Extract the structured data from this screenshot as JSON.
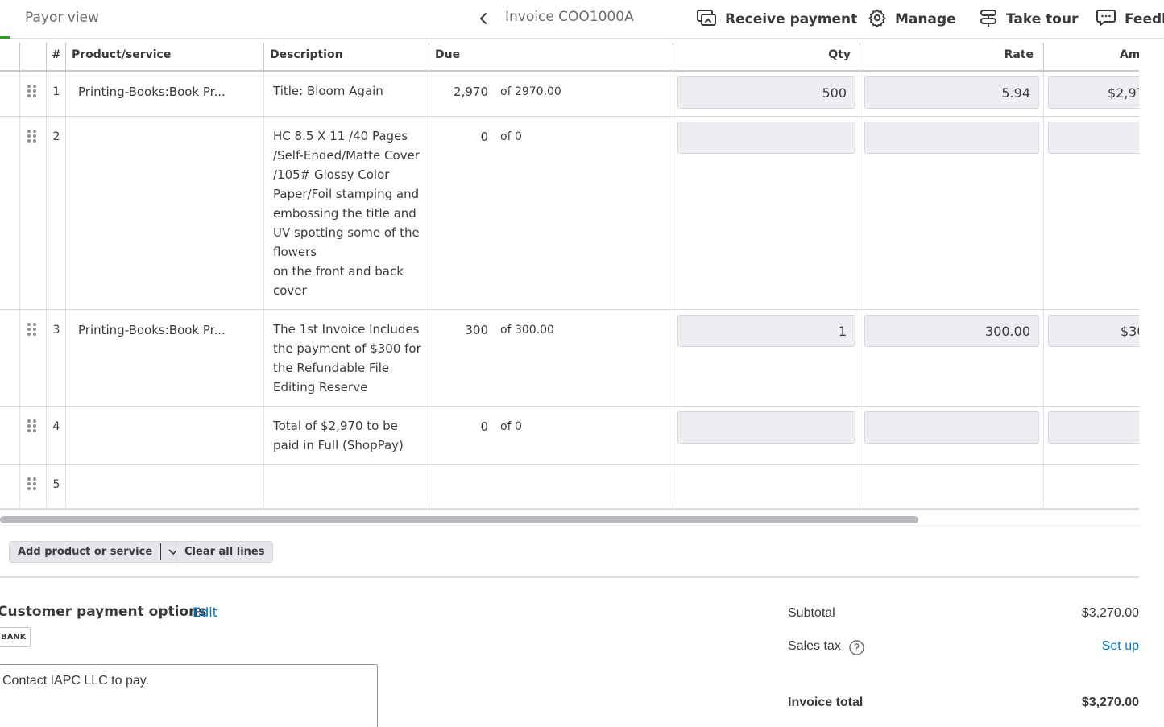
{
  "topbar": {
    "payor_view": "Payor view",
    "invoice_title": "Invoice COO1000A",
    "receive_payment": "Receive payment",
    "manage": "Manage",
    "take_tour": "Take tour",
    "feedback": "Feedb",
    "icons": [
      "chevron-left-icon",
      "receive-payment-icon",
      "gear-icon",
      "signpost-icon",
      "chat-bubble-icon"
    ]
  },
  "table": {
    "headers": {
      "num": "#",
      "product": "Product/service",
      "description": "Description",
      "due": "Due",
      "qty": "Qty",
      "rate": "Rate",
      "amount": "Am"
    },
    "rows": [
      {
        "num": "1",
        "product": "Printing-Books:Book Pr...",
        "description": "Title: Bloom Again",
        "due": "2,970",
        "due_of": "of 2970.00",
        "qty": "500",
        "rate": "5.94",
        "amount": "$2,97"
      },
      {
        "num": "2",
        "product": "",
        "description": "HC 8.5 X 11 /40 Pages\n/Self-Ended/Matte Cover\n/105#  Glossy Color\nPaper/Foil stamping and\nembossing the title and\nUV spotting some of the\nflowers\non the front and back\ncover",
        "due": "0",
        "due_of": "of 0",
        "qty": "",
        "rate": "",
        "amount": ""
      },
      {
        "num": "3",
        "product": "Printing-Books:Book Pr...",
        "description": "The 1st Invoice Includes\nthe payment of $300 for\nthe Refundable File\nEditing Reserve",
        "due": "300",
        "due_of": "of 300.00",
        "qty": "1",
        "rate": "300.00",
        "amount": "$30"
      },
      {
        "num": "4",
        "product": "",
        "description": "Total of $2,970  to be\npaid in Full (ShopPay)",
        "due": "0",
        "due_of": "of 0",
        "qty": "",
        "rate": "",
        "amount": ""
      },
      {
        "num": "5",
        "product": "",
        "description": "",
        "due": "",
        "due_of": "",
        "qty": "",
        "rate": "",
        "amount": ""
      }
    ]
  },
  "actions": {
    "add_product": "Add product or service",
    "clear_lines": "Clear all lines"
  },
  "payment_options": {
    "title": "Customer payment options",
    "edit": "Edit",
    "badge": "BANK",
    "message": "Contact IAPC LLC to pay."
  },
  "totals": {
    "subtotal_label": "Subtotal",
    "subtotal_value": "$3,270.00",
    "sales_tax_label": "Sales tax",
    "sales_tax_action": "Set up",
    "invoice_total_label": "Invoice total",
    "invoice_total_value": "$3,270.00"
  },
  "colors": {
    "accent_green": "#2ca01c",
    "link_blue": "#0077c5",
    "text": "#393a3d"
  }
}
